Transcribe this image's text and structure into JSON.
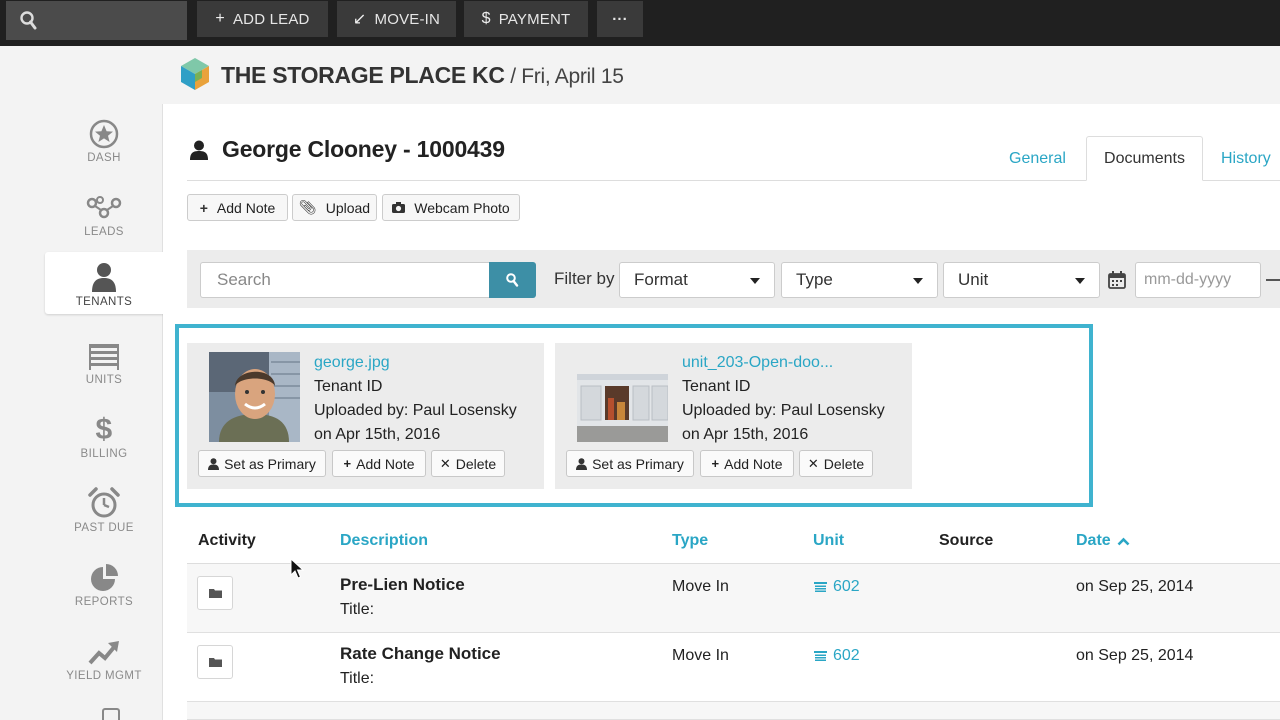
{
  "topbar": {
    "buttons": [
      {
        "icon": "plus-icon",
        "label": "ADD LEAD"
      },
      {
        "icon": "arrow-down-left-icon",
        "label": "MOVE-IN"
      },
      {
        "icon": "dollar-icon",
        "label": "PAYMENT"
      },
      {
        "icon": "ellipsis-icon",
        "label": "···"
      }
    ]
  },
  "header": {
    "facility": "THE STORAGE PLACE KC",
    "date": " / Fri, April 15"
  },
  "sidebar": {
    "items": [
      {
        "label": "DASH",
        "icon": "star-icon"
      },
      {
        "label": "LEADS",
        "icon": "leads-network-icon"
      },
      {
        "label": "TENANTS",
        "icon": "person-icon",
        "active": true
      },
      {
        "label": "UNITS",
        "icon": "units-list-icon"
      },
      {
        "label": "BILLING",
        "icon": "dollar-icon"
      },
      {
        "label": "PAST DUE",
        "icon": "alarm-clock-icon"
      },
      {
        "label": "REPORTS",
        "icon": "pie-chart-icon"
      },
      {
        "label": "YIELD MGMT",
        "icon": "trend-up-icon"
      }
    ]
  },
  "tenant": {
    "name": "George Clooney - 1000439"
  },
  "tabs": [
    {
      "label": "General"
    },
    {
      "label": "Documents",
      "active": true
    },
    {
      "label": "History"
    }
  ],
  "actions": {
    "add_note": "Add Note",
    "upload": "Upload",
    "webcam": "Webcam Photo"
  },
  "filters": {
    "search_placeholder": "Search",
    "filter_by": "Filter by",
    "format": "Format",
    "type": "Type",
    "unit": "Unit",
    "date_placeholder": "mm-dd-yyyy"
  },
  "documents": [
    {
      "filename": "george.jpg",
      "doc_type": "Tenant ID",
      "uploaded_by": "Uploaded by: Paul Losensky",
      "uploaded_on": "on Apr 15th, 2016",
      "btn_primary": "Set as Primary",
      "btn_note": "Add Note",
      "btn_delete": "Delete"
    },
    {
      "filename": "unit_203-Open-doo...",
      "doc_type": "Tenant ID",
      "uploaded_by": "Uploaded by: Paul Losensky",
      "uploaded_on": "on Apr 15th, 2016",
      "btn_primary": "Set as Primary",
      "btn_note": "Add Note",
      "btn_delete": "Delete"
    }
  ],
  "table": {
    "headers": {
      "activity": "Activity",
      "description": "Description",
      "type": "Type",
      "unit": "Unit",
      "source": "Source",
      "date": "Date"
    },
    "sort_indicator": "chevron-up-icon",
    "rows": [
      {
        "description": "Pre-Lien Notice",
        "title": "Title:",
        "type": "Move In",
        "unit": "602",
        "source": "",
        "date": "on Sep 25, 2014"
      },
      {
        "description": "Rate Change Notice",
        "title": "Title:",
        "type": "Move In",
        "unit": "602",
        "source": "",
        "date": "on Sep 25, 2014"
      }
    ]
  },
  "colors": {
    "accent": "#2aa6c5",
    "highlight_border": "#3fb3cf",
    "search_button": "#3d8fa6",
    "topbar": "#202020"
  }
}
